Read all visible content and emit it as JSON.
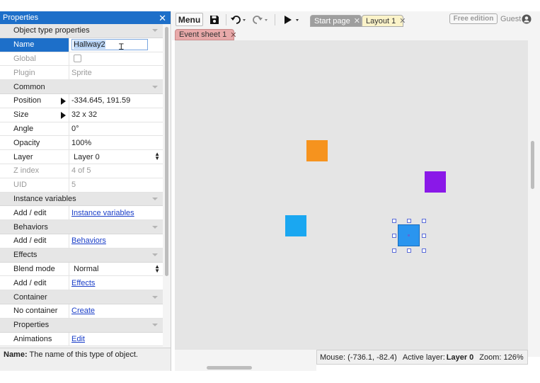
{
  "properties_panel": {
    "title": "Properties",
    "close_glyph": "✕",
    "sections": {
      "object_type": "Object type properties",
      "common": "Common",
      "instance_variables": "Instance variables",
      "behaviors": "Behaviors",
      "effects": "Effects",
      "container": "Container",
      "properties": "Properties"
    },
    "rows": {
      "name_label": "Name",
      "name_value": "Hallway2",
      "global_label": "Global",
      "plugin_label": "Plugin",
      "plugin_value": "Sprite",
      "position_label": "Position",
      "position_value": "-334.645, 191.59",
      "size_label": "Size",
      "size_value": "32 x 32",
      "angle_label": "Angle",
      "angle_value": "0°",
      "opacity_label": "Opacity",
      "opacity_value": "100%",
      "layer_label": "Layer",
      "layer_value": "Layer 0",
      "zindex_label": "Z index",
      "zindex_value": "4 of 5",
      "uid_label": "UID",
      "uid_value": "5",
      "instvars_label": "Add / edit",
      "instvars_link": "Instance variables",
      "behaviors_label": "Add / edit",
      "behaviors_link": "Behaviors",
      "blend_label": "Blend mode",
      "blend_value": "Normal",
      "effects_label": "Add / edit",
      "effects_link": "Effects",
      "container_label": "No container",
      "container_link": "Create",
      "animations_label": "Animations",
      "animations_link": "Edit"
    },
    "hint": {
      "label": "Name:",
      "text": "The name of this type of object."
    }
  },
  "toolbar": {
    "menu_label": "Menu",
    "tabs": {
      "start_page": "Start page",
      "layout": "Layout 1",
      "event_sheet": "Event sheet 1",
      "close_glyph": "✕"
    },
    "free_edition": "Free edition",
    "user": "Guest"
  },
  "status_bar": {
    "mouse": "Mouse: (-736.1, -82.4)",
    "active_layer_label": "Active layer:",
    "active_layer_value": "Layer 0",
    "zoom": "Zoom: 126%"
  },
  "colors": {
    "accent": "#1d6fc9",
    "orange_sprite": "#f6931e",
    "purple_sprite": "#8a18e8",
    "cyan_sprite": "#1aa7f1",
    "blue_sprite": "#2a95ef"
  }
}
